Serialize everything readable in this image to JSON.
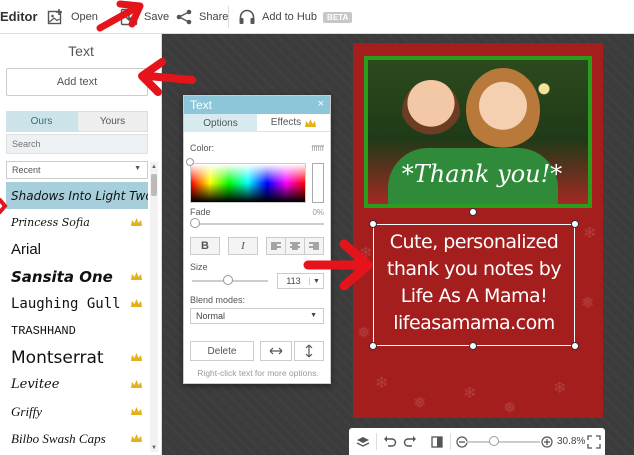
{
  "app": {
    "title": "Editor"
  },
  "toolbar": {
    "open_label": "Open",
    "save_label": "Save",
    "share_label": "Share",
    "hub_label": "Add to Hub",
    "hub_badge": "BETA"
  },
  "text_panel": {
    "title": "Text",
    "add_text_label": "Add text",
    "tabs": [
      "Ours",
      "Yours"
    ],
    "search_placeholder": "Search",
    "filter_value": "Recent",
    "fonts": [
      {
        "name": "Shadows Into Light Two",
        "premium": false,
        "selected": true
      },
      {
        "name": "Princess Sofia",
        "premium": true,
        "selected": false
      },
      {
        "name": "Arial",
        "premium": false,
        "selected": false
      },
      {
        "name": "Sansita One",
        "premium": true,
        "selected": false
      },
      {
        "name": "Laughing Gull",
        "premium": true,
        "selected": false
      },
      {
        "name": "TRASHHAND",
        "premium": false,
        "selected": false
      },
      {
        "name": "Montserrat",
        "premium": true,
        "selected": false
      },
      {
        "name": "Levitee",
        "premium": true,
        "selected": false
      },
      {
        "name": "Griffy",
        "premium": true,
        "selected": false
      },
      {
        "name": "Bilbo Swash Caps",
        "premium": true,
        "selected": false
      }
    ]
  },
  "text_popup": {
    "title": "Text",
    "close": "×",
    "tabs": [
      "Options",
      "Effects"
    ],
    "color_label": "Color:",
    "color_value": "ffffff",
    "fade_label": "Fade",
    "fade_value": "0%",
    "bold_label": "B",
    "italic_label": "I",
    "size_label": "Size",
    "size_value": "113",
    "blend_label": "Blend modes:",
    "blend_value": "Normal",
    "delete_label": "Delete",
    "hint": "Right-click text for more options.",
    "colors": {
      "header": "#8dc6d8",
      "active_tab": "#d7eaf0"
    }
  },
  "card": {
    "photo_caption": "*Thank you!*",
    "message_lines": [
      "Cute, personalized",
      "thank you notes by",
      "Life As A Mama!",
      "lifeasamama.com"
    ],
    "colors": {
      "background": "#a51e1e",
      "frame": "#2a9d1c"
    }
  },
  "bottom_bar": {
    "zoom": "30.8%"
  },
  "annotations": {
    "arrow_color": "#e5141b"
  }
}
